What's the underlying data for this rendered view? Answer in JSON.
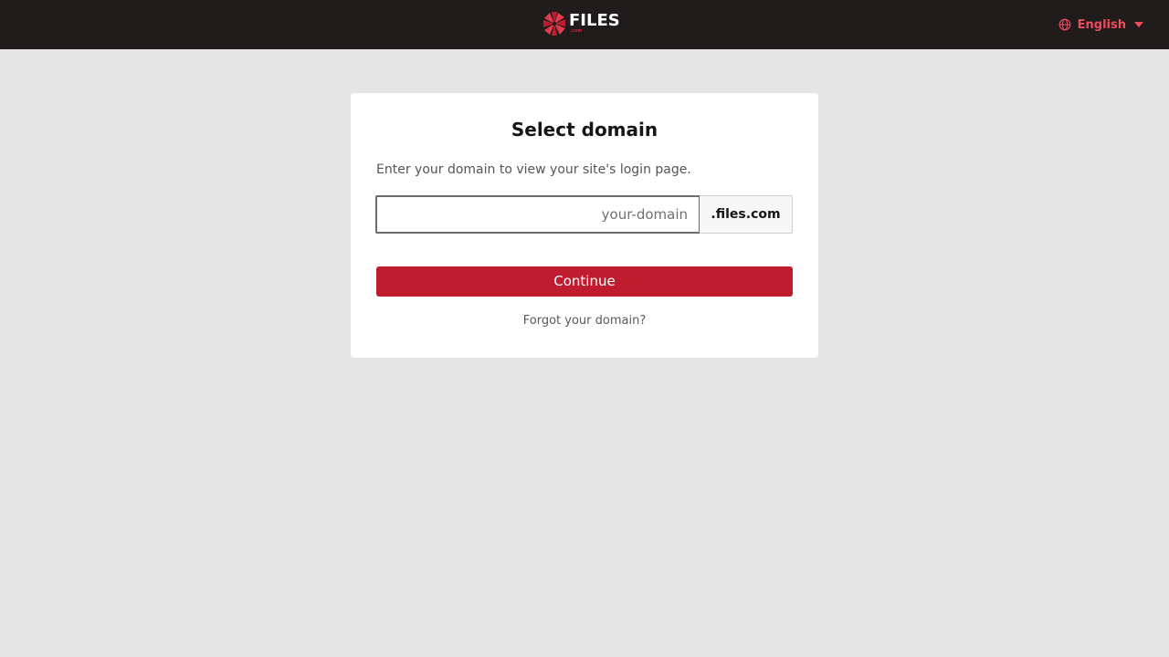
{
  "header": {
    "logo_text": "FILES",
    "logo_subtext": ".com",
    "language_label": "English",
    "accent_color": "#ef4b5f",
    "bar_color": "#201c1c"
  },
  "card": {
    "title": "Select domain",
    "description": "Enter your domain to view your site's login page.",
    "domain_input": {
      "value": "",
      "placeholder": "your-domain"
    },
    "domain_suffix": ".files.com",
    "continue_label": "Continue",
    "forgot_label": "Forgot your domain?"
  },
  "colors": {
    "primary_button": "#c01c30",
    "background": "#e5e5e5"
  },
  "icons": {
    "logo": "files-pinwheel-logo-icon",
    "language": "globe-icon",
    "dropdown": "caret-down-icon"
  }
}
